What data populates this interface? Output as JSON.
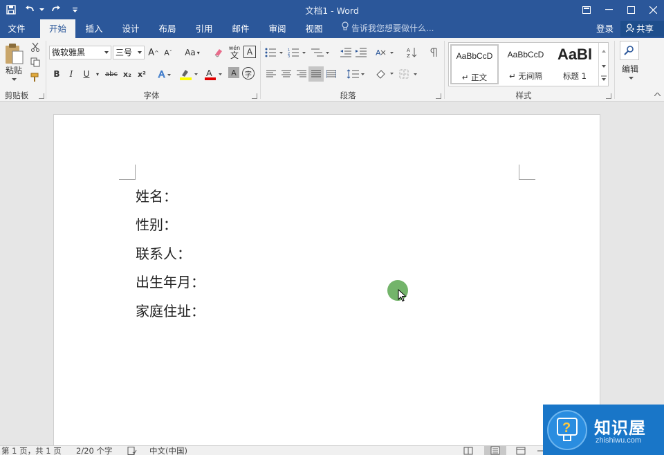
{
  "window": {
    "title": "文档1 - Word"
  },
  "tabs": [
    {
      "label": "文件"
    },
    {
      "label": "开始"
    },
    {
      "label": "插入"
    },
    {
      "label": "设计"
    },
    {
      "label": "布局"
    },
    {
      "label": "引用"
    },
    {
      "label": "邮件"
    },
    {
      "label": "审阅"
    },
    {
      "label": "视图"
    }
  ],
  "tell_me": "告诉我您想要做什么...",
  "account": {
    "login": "登录",
    "share": "共享"
  },
  "clipboard": {
    "paste": "粘贴",
    "group": "剪贴板"
  },
  "font": {
    "name": "微软雅黑",
    "size": "三号",
    "change_case": "Aa",
    "pinyin_top": "wén",
    "pinyin_char": "文",
    "char_border": "A",
    "bold": "B",
    "italic": "I",
    "underline": "U",
    "strikethrough": "abc",
    "subscript": "x₂",
    "superscript": "x²",
    "enclose": "字",
    "group": "字体",
    "highlight_color": "#ffff00",
    "font_color": "#e00000"
  },
  "paragraph": {
    "group": "段落"
  },
  "styles": {
    "group": "样式",
    "items": [
      {
        "preview": "AaBbCcD",
        "name": "↵ 正文"
      },
      {
        "preview": "AaBbCcD",
        "name": "↵ 无间隔"
      },
      {
        "preview": "AaBl",
        "name": "标题 1"
      }
    ]
  },
  "editing": {
    "label": "编辑"
  },
  "document": {
    "lines": [
      "姓名：",
      "性别：",
      "联系人：",
      "出生年月：",
      "家庭住址："
    ]
  },
  "status": {
    "page": "第 1 页，共 1 页",
    "words": "2/20 个字",
    "language": "中文(中国)"
  },
  "watermark": {
    "title": "知识屋",
    "url": "zhishiwu.com"
  },
  "colors": {
    "accent": "#2b579a",
    "ribbon": "#f3f3f3"
  }
}
